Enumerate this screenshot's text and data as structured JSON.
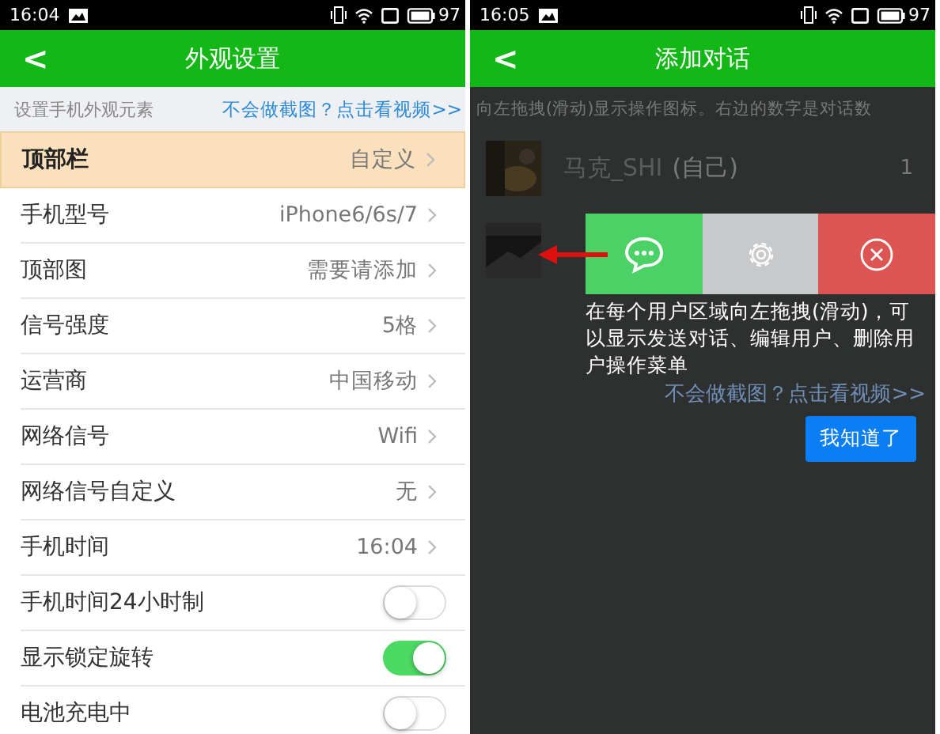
{
  "settings_screen": {
    "status_bar": {
      "time": "16:04",
      "battery": "97"
    },
    "header": {
      "back": "<",
      "title": "外观设置"
    },
    "subheader": {
      "text": "设置手机外观元素",
      "link": "不会做截图？点击看视频>>"
    },
    "rows": [
      {
        "kind": "value",
        "label": "顶部栏",
        "value": "自定义",
        "selected": true
      },
      {
        "kind": "value",
        "label": "手机型号",
        "value": "iPhone6/6s/7",
        "selected": false
      },
      {
        "kind": "value",
        "label": "顶部图",
        "value": "需要请添加",
        "selected": false
      },
      {
        "kind": "value",
        "label": "信号强度",
        "value": "5格",
        "selected": false
      },
      {
        "kind": "value",
        "label": "运营商",
        "value": "中国移动",
        "selected": false
      },
      {
        "kind": "value",
        "label": "网络信号",
        "value": "Wifi",
        "selected": false
      },
      {
        "kind": "value",
        "label": "网络信号自定义",
        "value": "无",
        "selected": false
      },
      {
        "kind": "value",
        "label": "手机时间",
        "value": "16:04",
        "selected": false
      },
      {
        "kind": "toggle",
        "label": "手机时间24小时制",
        "on": false,
        "selected": false
      },
      {
        "kind": "toggle",
        "label": "显示锁定旋转",
        "on": true,
        "selected": false
      },
      {
        "kind": "toggle",
        "label": "电池充电中",
        "on": false,
        "selected": false
      }
    ]
  },
  "chat_screen": {
    "status_bar": {
      "time": "16:05",
      "battery": "97"
    },
    "header": {
      "back": "<",
      "title": "添加对话"
    },
    "hint": "向左拖拽(滑动)显示操作图标。右边的数字是对话数",
    "user": {
      "name": "马克_SHI",
      "note": "(自己)",
      "count": "1"
    },
    "swipe_actions": [
      {
        "kind": "chat"
      },
      {
        "kind": "settings"
      },
      {
        "kind": "delete"
      }
    ],
    "guide": {
      "text": "在每个用户区域向左拖拽(滑动)，可以显示发送对话、编辑用户、删除用户操作菜单",
      "link": "不会做截图？点击看视频>>",
      "button": "我知道了"
    }
  }
}
